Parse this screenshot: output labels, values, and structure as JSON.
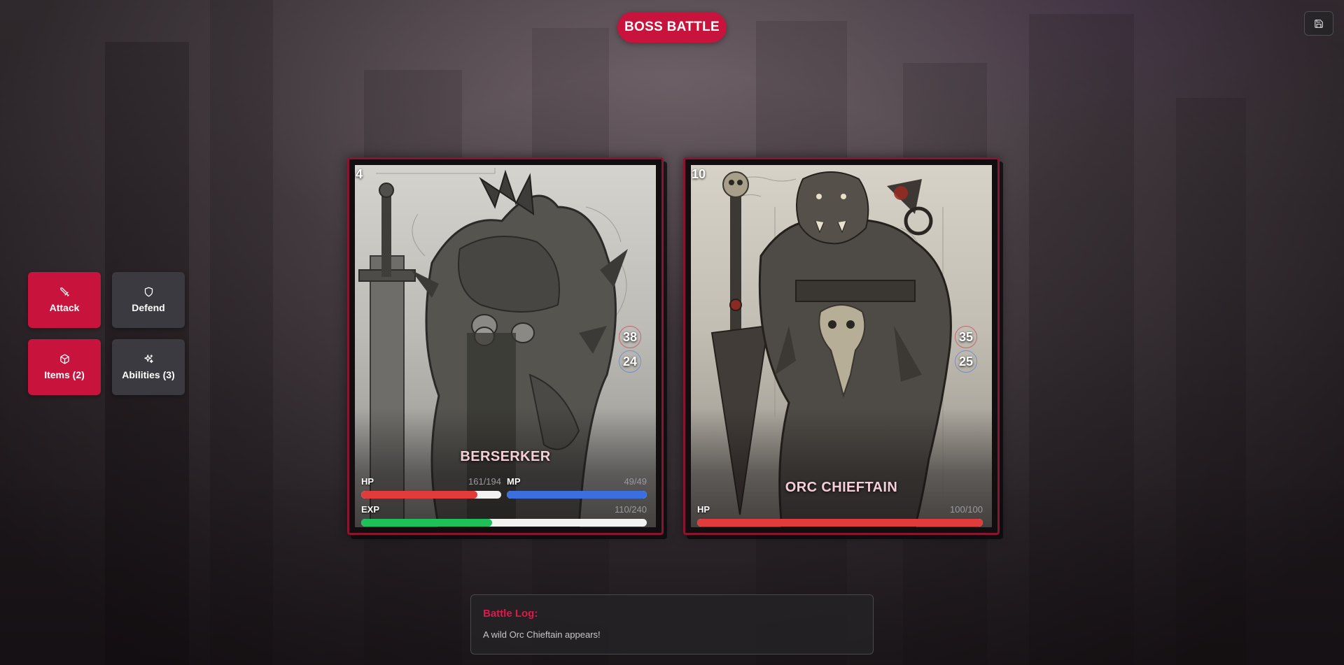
{
  "header": {
    "title": "BOSS BATTLE"
  },
  "toolbar": {
    "save_icon": "save-icon"
  },
  "actions": [
    {
      "label": "Attack",
      "icon": "sword-icon",
      "style": "red"
    },
    {
      "label": "Defend",
      "icon": "shield-icon",
      "style": "gray"
    },
    {
      "label": "Items (2)",
      "icon": "box-icon",
      "style": "red"
    },
    {
      "label": "Abilities (3)",
      "icon": "sparkles-icon",
      "style": "gray"
    }
  ],
  "player": {
    "level": "4",
    "name": "BERSERKER",
    "attack": "38",
    "defense": "24",
    "hp": {
      "label": "HP",
      "text": "161/194",
      "current": 161,
      "max": 194,
      "color": "#e03c3c"
    },
    "mp": {
      "label": "MP",
      "text": "49/49",
      "current": 49,
      "max": 49,
      "color": "#3b6fe0"
    },
    "exp": {
      "label": "EXP",
      "text": "110/240",
      "current": 110,
      "max": 240,
      "color": "#1fbf5a"
    }
  },
  "enemy": {
    "level": "10",
    "name": "ORC CHIEFTAIN",
    "attack": "35",
    "defense": "25",
    "hp": {
      "label": "HP",
      "text": "100/100",
      "current": 100,
      "max": 100,
      "color": "#e03c3c"
    }
  },
  "battle_log": {
    "title": "Battle Log:",
    "entries": [
      "A wild Orc Chieftain appears!"
    ]
  },
  "colors": {
    "accent": "#c8143d",
    "card_border": "#8a1530",
    "button_gray": "#3a3a40"
  }
}
